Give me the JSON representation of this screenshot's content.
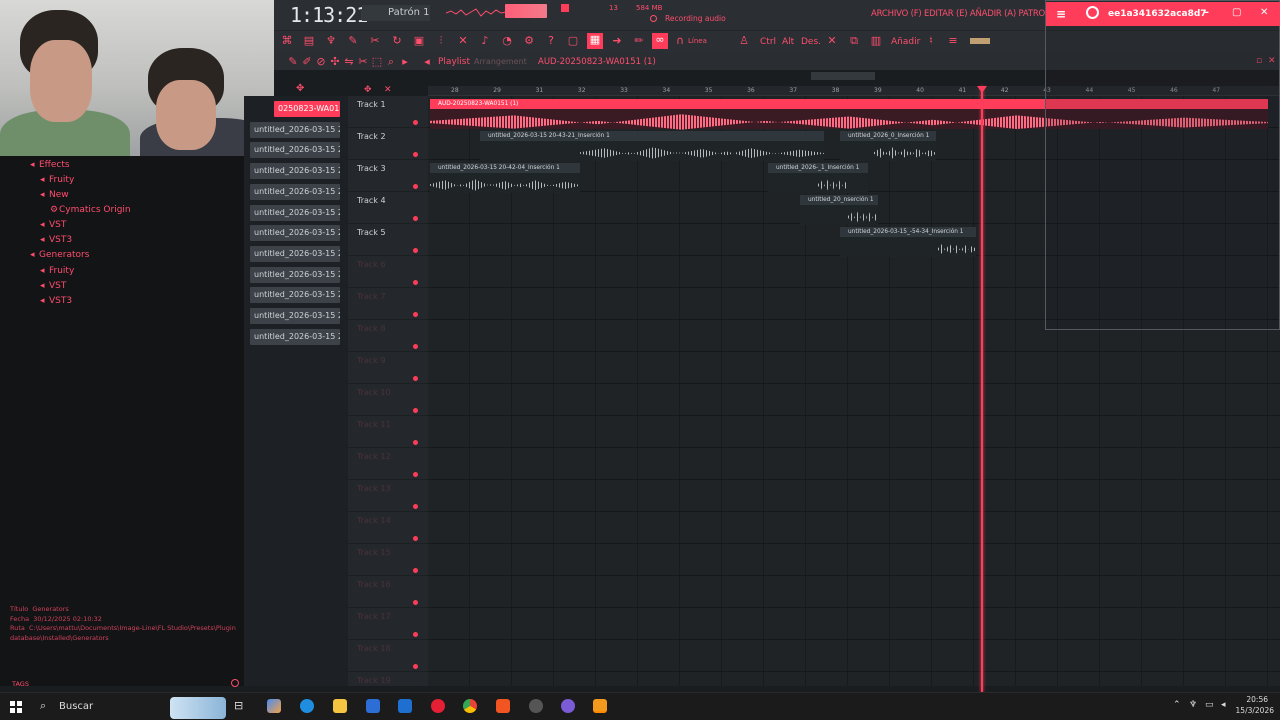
{
  "transport": {
    "time": "1:13:21",
    "pattern": "Patrón 1",
    "memory": "584 MB",
    "cpu": "13",
    "status": "Recording audio"
  },
  "menu": {
    "text": "ARCHIVO (F) EDITAR (E) AÑADIR (A) PATRONES (P) V"
  },
  "toolbar2": {
    "snap": "Línea",
    "ctrl": "Ctrl",
    "alt": "Alt",
    "des": "Des.",
    "add": "Añadir"
  },
  "playlist": {
    "title": "Playlist",
    "subtitle": "Arrangement",
    "name": "AUD-20250823-WA0151 (1)"
  },
  "browser": {
    "items": [
      {
        "label": "Effects",
        "level": 0
      },
      {
        "label": "Fruity",
        "level": 1
      },
      {
        "label": "New",
        "level": 1
      },
      {
        "label": "Cymatics Origin",
        "level": 2
      },
      {
        "label": "VST",
        "level": 1
      },
      {
        "label": "VST3",
        "level": 1
      },
      {
        "label": "Generators",
        "level": 0
      },
      {
        "label": "Fruity",
        "level": 1
      },
      {
        "label": "VST",
        "level": 1
      },
      {
        "label": "VST3",
        "level": 1
      }
    ],
    "info_title_label": "Título",
    "info_title": "Generators",
    "info_date_label": "Fecha",
    "info_date": "30/12/2025 02:10:32",
    "info_path_label": "Ruta",
    "info_path": "C:\\Users\\mattu\\Documents\\Image-Line\\FL Studio\\Presets\\Plugin database\\Installed\\Generators",
    "tags": "TAGS"
  },
  "cliplist": [
    "0250823-WA01...",
    "untitled_2026-03-15 20-",
    "untitled_2026-03-15 20-",
    "untitled_2026-03-15 20-",
    "untitled_2026-03-15 20-",
    "untitled_2026-03-15 20-",
    "untitled_2026-03-15 20-",
    "untitled_2026-03-15 20-",
    "untitled_2026-03-15 20-",
    "untitled_2026-03-15 20-",
    "untitled_2026-03-15 20-",
    "untitled_2026-03-15 20-"
  ],
  "ruler": [
    "28",
    "29",
    "31",
    "32",
    "33",
    "34",
    "35",
    "36",
    "37",
    "38",
    "39",
    "40",
    "41",
    "42",
    "43",
    "44",
    "45",
    "46",
    "47"
  ],
  "tracks": [
    "Track 1",
    "Track 2",
    "Track 3",
    "Track 4",
    "Track 5",
    "Track 6",
    "Track 7",
    "Track 8",
    "Track 9",
    "Track 10",
    "Track 11",
    "Track 12",
    "Track 13",
    "Track 14",
    "Track 15",
    "Track 16",
    "Track 17",
    "Track 18",
    "Track 19"
  ],
  "clips": {
    "c1": "AUD-20250823-WA0151 (1)",
    "c2": "untitled_2026-03-15 20-43-21_Inserción 1",
    "c3": "untitled_2026_0_Inserción 1",
    "c4": "untitled_2026-03-15 20-42-04_Inserción 1",
    "c5": "untitled_2026-_1_Inserción 1",
    "c6": "untitled_20_nserción 1",
    "c7": "untitled_2026-03-15_-54-34_Inserción 1"
  },
  "overlay": {
    "title": "ee1a341632aca8d7"
  },
  "taskbar": {
    "search": "Buscar",
    "time": "20:56",
    "date": "15/3/2026"
  },
  "colors": {
    "accent": "#ff3d5a",
    "background": "#1a1d20"
  }
}
